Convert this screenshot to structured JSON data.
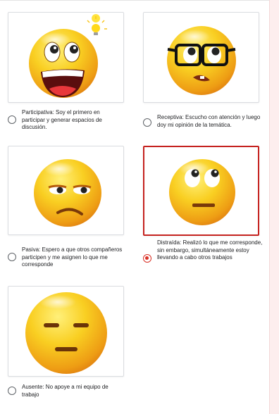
{
  "options": [
    {
      "icon": "happy-emoji-with-lightbulb-icon",
      "label": "Participativa: Soy el primero en participar y generar espacios de discusión.",
      "selected": false
    },
    {
      "icon": "nerd-glasses-emoji-icon",
      "label": "Receptiva: Escucho con atención y luego doy mi opinión de la temática.",
      "selected": false
    },
    {
      "icon": "unamused-emoji-icon",
      "label": "Pasiva: Espero a que otros compañeros participen y me asignen lo que me corresponde",
      "selected": false
    },
    {
      "icon": "eye-roll-emoji-icon",
      "label": "Distraída: Realizó lo que me corresponde, sin embargo, simultáneamente estoy llevando a cabo otros trabajos",
      "selected": true
    },
    {
      "icon": "expressionless-emoji-icon",
      "label": "Ausente: No apoye a mi equipo de trabajo",
      "selected": false
    }
  ],
  "colors": {
    "accent": "#d93025",
    "selected_border": "#c5221f",
    "emoji_yellow": "#f7c51d",
    "emoji_orange": "#e8941a"
  }
}
